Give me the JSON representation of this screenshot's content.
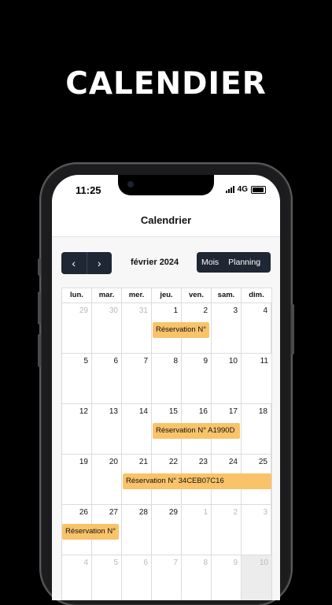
{
  "headline": "CALENDIER",
  "status_bar": {
    "time": "11:25",
    "network": "4G"
  },
  "app": {
    "title": "Calendrier"
  },
  "calendar": {
    "month_label": "février 2024",
    "view_buttons": [
      "Mois",
      "Planning"
    ],
    "weekdays": [
      "lun.",
      "mar.",
      "mer.",
      "jeu.",
      "ven.",
      "sam.",
      "dim."
    ],
    "weeks": [
      [
        "29",
        "30",
        "31",
        "1",
        "2",
        "3",
        "4"
      ],
      [
        "5",
        "6",
        "7",
        "8",
        "9",
        "10",
        "11"
      ],
      [
        "12",
        "13",
        "14",
        "15",
        "16",
        "17",
        "18"
      ],
      [
        "19",
        "20",
        "21",
        "22",
        "23",
        "24",
        "25"
      ],
      [
        "26",
        "27",
        "28",
        "29",
        "1",
        "2",
        "3"
      ],
      [
        "4",
        "5",
        "6",
        "7",
        "8",
        "9",
        "10"
      ]
    ],
    "events": [
      {
        "label": "Réservation N°"
      },
      {
        "label": "Réservation N° A1990D"
      },
      {
        "label": "Réservation N° 34CEB07C16"
      },
      {
        "label": "Réservation N°"
      }
    ],
    "accent_color": "#f9c36a",
    "nav_color": "#1e2733"
  }
}
